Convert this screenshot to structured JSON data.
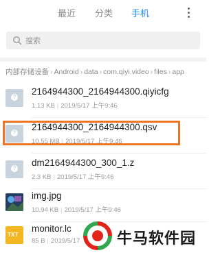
{
  "tabs": [
    {
      "label": "最近",
      "active": false
    },
    {
      "label": "分类",
      "active": false
    },
    {
      "label": "手机",
      "active": true
    }
  ],
  "search": {
    "placeholder": "搜索"
  },
  "breadcrumb": [
    "内部存储设备",
    "Android",
    "data",
    "com.qiyi.video",
    "files",
    "app"
  ],
  "files": [
    {
      "name": "2164944300_2164944300.qiyicfg",
      "size": "1.13 KB",
      "date": "2019/5/17 上午9:46",
      "icon": "unknown-file-icon"
    },
    {
      "name": "2164944300_2164944300.qsv",
      "size": "10.55 MB",
      "date": "2019/5/17 上午9:46",
      "icon": "unknown-file-icon",
      "highlighted": true
    },
    {
      "name": "dm2164944300_300_1.z",
      "size": "2.3 KB",
      "date": "2019/5/17 上午9:46",
      "icon": "unknown-file-icon"
    },
    {
      "name": "img.jpg",
      "size": "10.94 KB",
      "date": "2019/5/17 上午9:46",
      "icon": "image-thumbnail-icon"
    },
    {
      "name": "monitor.lc",
      "size": "85 B",
      "date": "2019/5/17",
      "icon": "txt-file-icon",
      "icon_label": "TXT"
    }
  ],
  "watermark": {
    "text": "牛马软件园"
  },
  "colors": {
    "accent": "#1f8ef1",
    "highlight": "#ed7422",
    "txt_icon": "#f5b623"
  }
}
